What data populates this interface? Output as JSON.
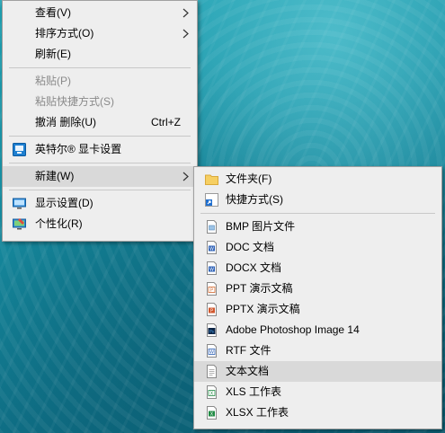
{
  "main_menu": {
    "view": "查看(V)",
    "sort": "排序方式(O)",
    "refresh": "刷新(E)",
    "paste": "粘贴(P)",
    "paste_shortcut": "粘贴快捷方式(S)",
    "undo": "撤消 删除(U)",
    "undo_shortcut": "Ctrl+Z",
    "intel_graphics": "英特尔® 显卡设置",
    "new": "新建(W)",
    "display_settings": "显示设置(D)",
    "personalize": "个性化(R)"
  },
  "new_submenu": {
    "folder": "文件夹(F)",
    "shortcut": "快捷方式(S)",
    "bmp": "BMP 图片文件",
    "doc": "DOC 文档",
    "docx": "DOCX 文档",
    "ppt": "PPT 演示文稿",
    "pptx": "PPTX 演示文稿",
    "psd": "Adobe Photoshop Image 14",
    "rtf": "RTF 文件",
    "txt": "文本文档",
    "xls": "XLS 工作表",
    "xlsx": "XLSX 工作表"
  },
  "icons": {
    "intel": "intel-graphics-icon",
    "display": "display-settings-icon",
    "personalize": "personalize-icon",
    "folder": "folder-icon",
    "shortcut": "shortcut-icon",
    "bmp": "bmp-file-icon",
    "doc": "word-doc-icon",
    "docx": "word-docx-icon",
    "ppt": "ppt-file-icon",
    "pptx": "pptx-file-icon",
    "psd": "photoshop-file-icon",
    "rtf": "rtf-file-icon",
    "txt": "text-file-icon",
    "xls": "xls-file-icon",
    "xlsx": "xlsx-file-icon"
  },
  "colors": {
    "menu_bg": "#eeeeee",
    "highlight": "#d9d9d9",
    "disabled_text": "#8a8a8a",
    "desktop": "#178fa3"
  }
}
